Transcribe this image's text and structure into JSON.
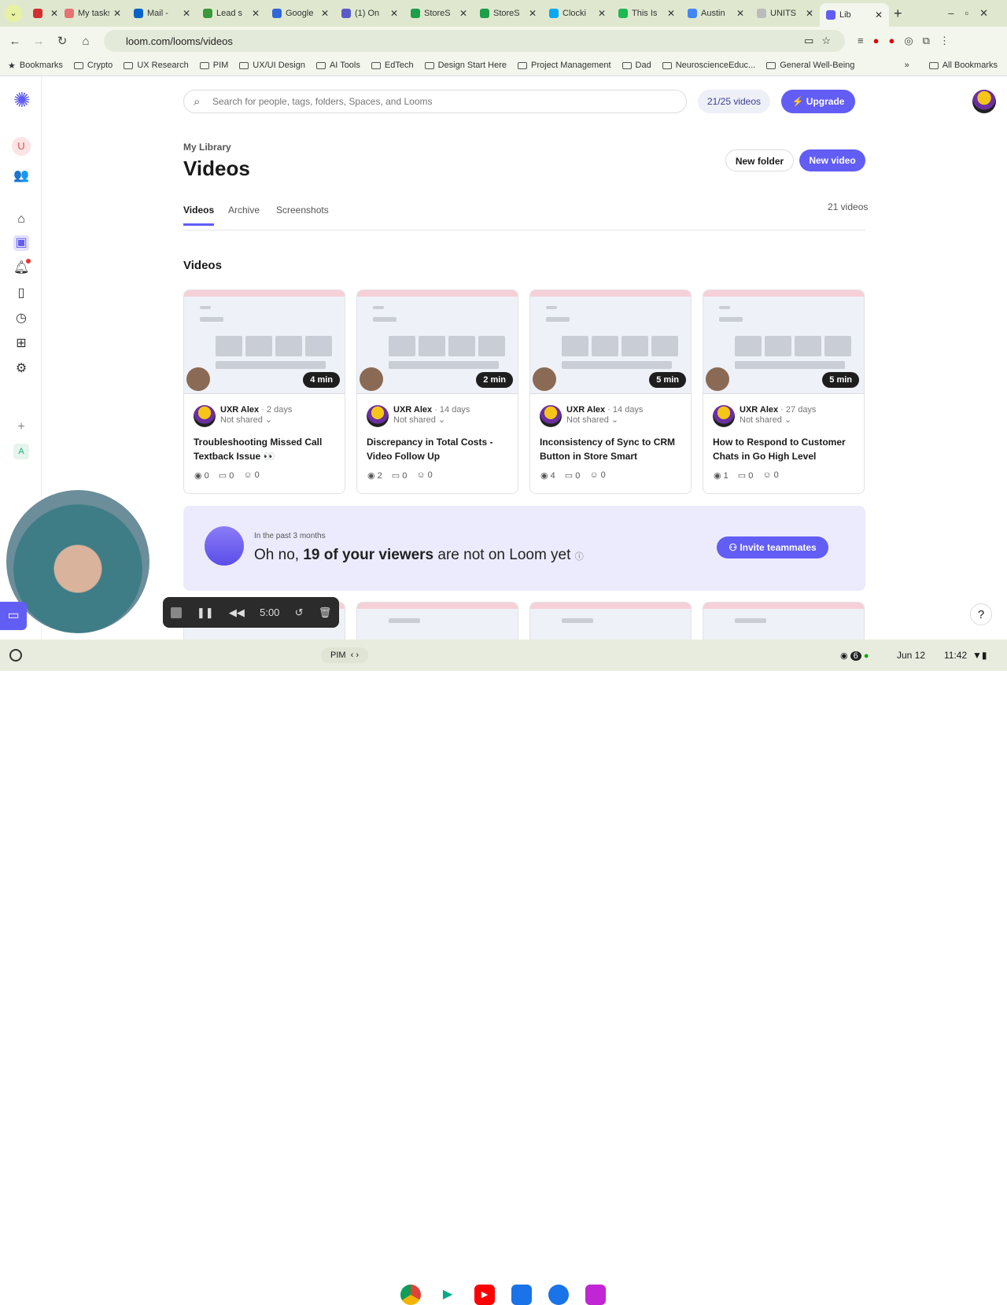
{
  "browser": {
    "tabs": [
      {
        "label": "",
        "color": "#d32f2f"
      },
      {
        "label": "My tasks",
        "color": "#e57373"
      },
      {
        "label": "Mail - ",
        "color": "#0a64c8"
      },
      {
        "label": "Lead s",
        "color": "#3a9a3a"
      },
      {
        "label": "Google",
        "color": "#3367d6"
      },
      {
        "label": "(1) On",
        "color": "#5a5ac8"
      },
      {
        "label": "StoreS",
        "color": "#1e9e4a"
      },
      {
        "label": "StoreS",
        "color": "#1e9e4a"
      },
      {
        "label": "Clocki",
        "color": "#03a9f4"
      },
      {
        "label": "This Is",
        "color": "#1db954"
      },
      {
        "label": "Austin",
        "color": "#4285f4"
      },
      {
        "label": "UNITS",
        "color": "#bbbbbb"
      },
      {
        "label": "Lib",
        "color": "#625df5"
      }
    ],
    "url": "loom.com/looms/videos",
    "bookmarks": [
      "Bookmarks",
      "Crypto",
      "UX Research",
      "PIM",
      "UX/UI Design",
      "AI Tools",
      "EdTech",
      "Design Start Here",
      "Project Management",
      "Dad",
      "NeuroscienceEduc...",
      "General Well-Being"
    ],
    "all_bookmarks": "All Bookmarks"
  },
  "header": {
    "search_placeholder": "Search for people, tags, folders, Spaces, and Looms",
    "quota": "21/25 videos",
    "upgrade": "Upgrade"
  },
  "sidebar": {
    "workspace_initial": "U",
    "space_initial": "A"
  },
  "page": {
    "breadcrumb": "My Library",
    "title": "Videos",
    "new_folder": "New folder",
    "new_video": "New video",
    "count": "21 videos",
    "section": "Videos",
    "tabs": [
      {
        "label": "Videos",
        "active": true
      },
      {
        "label": "Archive"
      },
      {
        "label": "Screenshots"
      }
    ]
  },
  "videos": [
    {
      "author": "UXR Alex",
      "age": "2 days",
      "sharing": "Not shared",
      "title": "Troubleshooting Missed Call Textback Issue 👀",
      "duration": "4 min",
      "views": "0",
      "comments": "0",
      "reactions": "0"
    },
    {
      "author": "UXR Alex",
      "age": "14 days",
      "sharing": "Not shared",
      "title": "Discrepancy in Total Costs - Video Follow Up",
      "duration": "2 min",
      "views": "2",
      "comments": "0",
      "reactions": "0"
    },
    {
      "author": "UXR Alex",
      "age": "14 days",
      "sharing": "Not shared",
      "title": "Inconsistency of Sync to CRM Button in Store Smart",
      "duration": "5 min",
      "views": "4",
      "comments": "0",
      "reactions": "0"
    },
    {
      "author": "UXR Alex",
      "age": "27 days",
      "sharing": "Not shared",
      "title": "How to Respond to Customer Chats in Go High Level",
      "duration": "5 min",
      "views": "1",
      "comments": "0",
      "reactions": "0"
    }
  ],
  "banner": {
    "kicker": "In the past 3 months",
    "pre": "Oh no, ",
    "bold": "19 of your viewers",
    "post": " are not on Loom yet",
    "cta": "Invite teammates"
  },
  "recorder": {
    "time": "5:00"
  },
  "shelf": {
    "desk": "PIM",
    "date": "Jun 12",
    "time": "11:42",
    "badge": "6"
  },
  "colors": {
    "accent": "#625df5",
    "banner": "#ecebfd"
  }
}
